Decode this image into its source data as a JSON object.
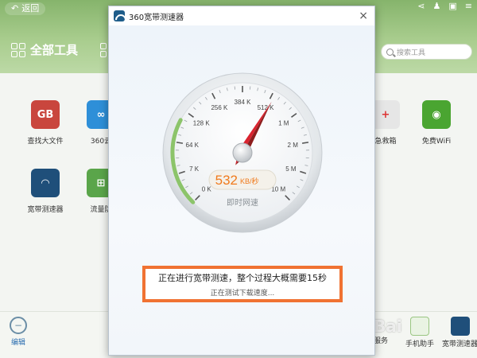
{
  "app": {
    "back_label": "返回",
    "all_tools_label": "全部工具",
    "search_placeholder": "搜索工具"
  },
  "tools": [
    {
      "label": "查找大文件",
      "icon": "gb-file-icon",
      "color": "#c9463d",
      "glyph": "GB"
    },
    {
      "label": "360云",
      "icon": "cloud-icon",
      "color": "#2e8fd8",
      "glyph": "∞"
    },
    {
      "label": "急救箱",
      "icon": "first-aid-icon",
      "color": "#e8e8e8",
      "glyph": "+"
    },
    {
      "label": "免费WiFi",
      "icon": "wifi-icon",
      "color": "#4aa531",
      "glyph": "◉"
    },
    {
      "label": "宽带测速器",
      "icon": "speedometer-icon",
      "color": "#1f4f7a",
      "glyph": "◠"
    },
    {
      "label": "流量防",
      "icon": "traffic-guard-icon",
      "color": "#5aa54a",
      "glyph": "⊞"
    }
  ],
  "bottom": {
    "edit_label": "编辑",
    "service_label": "服务",
    "phone_helper_label": "手机助手",
    "speedtest_label": "宽带测速器"
  },
  "dialog": {
    "title": "360宽带测速器",
    "close_glyph": "×"
  },
  "gauge": {
    "ticks": [
      "0 K",
      "7 K",
      "64 K",
      "128 K",
      "256 K",
      "384 K",
      "512 K",
      "1 M",
      "2 M",
      "5 M",
      "10 M"
    ],
    "speed_value": "532",
    "speed_unit": "KB/秒",
    "caption": "即时网速",
    "needle_index": 6.1,
    "accent_color": "#f07a1c"
  },
  "status": {
    "main": "正在进行宽带测速，整个过程大概需要15秒",
    "sub": "正在测试下载速度..."
  },
  "watermark": "Bai"
}
